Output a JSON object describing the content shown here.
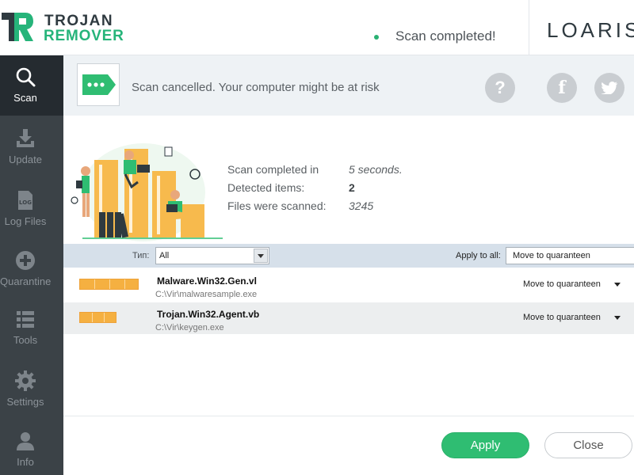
{
  "header": {
    "logo_line1": "TROJAN",
    "logo_line2": "REMOVER",
    "status_text": "Scan completed!",
    "brand": "LOARIS"
  },
  "sidebar": {
    "items": [
      {
        "label": "Scan",
        "icon": "search-icon",
        "active": true
      },
      {
        "label": "Update",
        "icon": "download-icon",
        "active": false
      },
      {
        "label": "Log Files",
        "icon": "log-file-icon",
        "active": false
      },
      {
        "label": "Quarantine",
        "icon": "plus-circle-icon",
        "active": false
      },
      {
        "label": "Tools",
        "icon": "list-icon",
        "active": false
      },
      {
        "label": "Settings",
        "icon": "gear-icon",
        "active": false
      },
      {
        "label": "Info",
        "icon": "user-icon",
        "active": false
      }
    ]
  },
  "notice": {
    "message": "Scan cancelled. Your computer might be at risk",
    "help_glyph": "?",
    "facebook_glyph": "f",
    "twitter_icon": "twitter-icon"
  },
  "summary": {
    "scan_completed_label": "Scan completed in",
    "scan_completed_value": "5 seconds.",
    "detected_label": "Detected items:",
    "detected_value": "2",
    "files_label": "Files were scanned:",
    "files_value": "3245"
  },
  "filter": {
    "label": "Тип:",
    "type_value": "All",
    "apply_all_label": "Apply to all:",
    "apply_all_value": "Move to quaranteen"
  },
  "results": [
    {
      "name": "Malware.Win32.Gen.vl",
      "path": "C:\\Vir\\malwaresample.exe",
      "action": "Move to quaranteen",
      "severity": 0.75
    },
    {
      "name": "Trojan.Win32.Agent.vb",
      "path": "C:\\Vir\\keygen.exe",
      "action": "Move to quaranteen",
      "severity": 0.45
    }
  ],
  "footer": {
    "apply_label": "Apply",
    "close_label": "Close"
  },
  "colors": {
    "accent_green": "#2fbd72",
    "sidebar_bg": "#3b4247",
    "sidebar_active": "#252b30",
    "severity_orange": "#f5b041"
  }
}
